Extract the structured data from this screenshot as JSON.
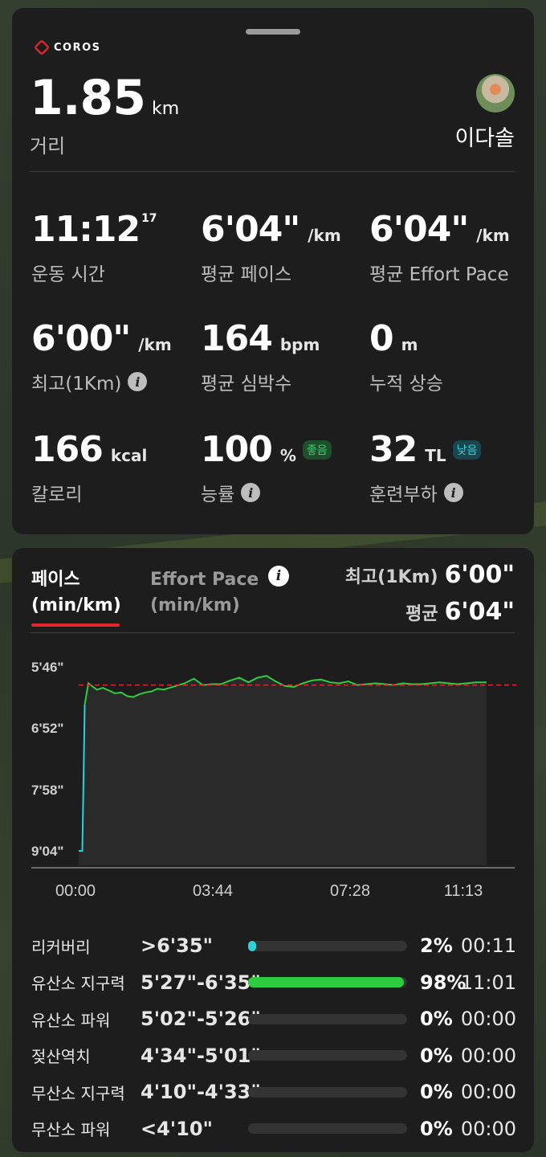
{
  "app": {
    "logo": "COROS"
  },
  "summary": {
    "distance": "1.85",
    "distance_unit": "km",
    "distance_label": "거리",
    "user_name": "이다솔"
  },
  "stats": [
    {
      "value": "11:12",
      "sup": "17",
      "unit": "",
      "label": "운동 시간"
    },
    {
      "value": "6'04\"",
      "unit": "/km",
      "label": "평균 페이스"
    },
    {
      "value": "6'04\"",
      "unit": "/km",
      "label": "평균 Effort Pace"
    },
    {
      "value": "6'00\"",
      "unit": "/km",
      "label": "최고(1Km)"
    },
    {
      "value": "164",
      "unit": "bpm",
      "label": "평균 심박수"
    },
    {
      "value": "0",
      "unit": "m",
      "label": "누적 상승"
    },
    {
      "value": "166",
      "unit": "kcal",
      "label": "칼로리"
    },
    {
      "value": "100",
      "unit": "%",
      "badge": "좋음",
      "label": "능률"
    },
    {
      "value": "32",
      "unit": "TL",
      "badge": "낮음",
      "label": "훈련부하"
    }
  ],
  "chart_panel": {
    "tab_pace_line1": "페이스",
    "tab_pace_line2": "(min/km)",
    "tab_effort_line1": "Effort Pace",
    "tab_effort_line2": "(min/km)",
    "best_label": "최고(1Km)",
    "best_value": "6'00\"",
    "avg_label": "평균",
    "avg_value": "6'04\""
  },
  "chart_data": {
    "type": "area",
    "y_ticks": [
      "5'46\"",
      "6'52\"",
      "7'58\"",
      "9'04\""
    ],
    "x_ticks": [
      "00:00",
      "03:44",
      "07:28",
      "11:13"
    ],
    "y_unit": "sec/km",
    "ylim": [
      346,
      544
    ],
    "avg_line": 364,
    "colors": {
      "line_start": "#2fd1d8",
      "line": "#2ecc40",
      "avg": "#e0262e",
      "fill": "#2a2a2a"
    },
    "series": [
      {
        "x": [
          0,
          6,
          10,
          16,
          22,
          30,
          40,
          50,
          60,
          70,
          80,
          90,
          100,
          110,
          120,
          130,
          140,
          150,
          160,
          175,
          190,
          205,
          220,
          235,
          250,
          265,
          280,
          295,
          310,
          325,
          340,
          355,
          370,
          385,
          400,
          415,
          430,
          445,
          460,
          475,
          490,
          505,
          520,
          535,
          550,
          565,
          580,
          595,
          610,
          625,
          640,
          655,
          673
        ],
        "values": [
          544,
          544,
          385,
          362,
          365,
          369,
          367,
          370,
          373,
          372,
          376,
          377,
          374,
          372,
          371,
          368,
          369,
          367,
          365,
          362,
          357,
          364,
          363,
          363,
          359,
          356,
          361,
          356,
          354,
          360,
          365,
          366,
          362,
          359,
          358,
          361,
          362,
          360,
          364,
          363,
          362,
          363,
          364,
          362,
          363,
          363,
          362,
          361,
          362,
          363,
          362,
          361,
          361
        ]
      }
    ]
  },
  "zones": [
    {
      "name": "리커버리",
      "range": ">6'35\"",
      "pct_value": 2,
      "pct": "2%",
      "time": "00:11",
      "color": "#2fd1d8"
    },
    {
      "name": "유산소 지구력",
      "range": "5'27\"-6'35\"",
      "pct_value": 98,
      "pct": "98%",
      "time": "11:01",
      "color": "#2ecc40"
    },
    {
      "name": "유산소 파워",
      "range": "5'02\"-5'26\"",
      "pct_value": 0,
      "pct": "0%",
      "time": "00:00",
      "color": "#f0c020"
    },
    {
      "name": "젖산역치",
      "range": "4'34\"-5'01\"",
      "pct_value": 0,
      "pct": "0%",
      "time": "00:00",
      "color": "#f08020"
    },
    {
      "name": "무산소 지구력",
      "range": "4'10\"-4'33\"",
      "pct_value": 0,
      "pct": "0%",
      "time": "00:00",
      "color": "#e0262e"
    },
    {
      "name": "무산소 파워",
      "range": "<4'10\"",
      "pct_value": 0,
      "pct": "0%",
      "time": "00:00",
      "color": "#a020c0"
    }
  ]
}
